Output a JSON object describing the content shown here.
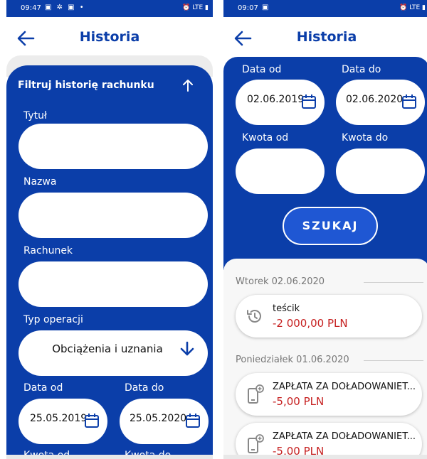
{
  "left": {
    "status": {
      "time": "09:47",
      "icons": "▣ ✲ ▣ •",
      "right_icons": "⏰ LTE ▮"
    },
    "header": {
      "title": "Historia"
    },
    "filter": {
      "title": "Filtruj historię rachunku",
      "tytul_label": "Tytuł",
      "nazwa_label": "Nazwa",
      "rachunek_label": "Rachunek",
      "typ_label": "Typ operacji",
      "typ_value": "Obciążenia i uznania",
      "date_from_label": "Data od",
      "date_to_label": "Data do",
      "date_from": "25.05.2019",
      "date_to": "25.05.2020",
      "amount_from_label": "Kwota od",
      "amount_to_label": "Kwota do"
    }
  },
  "right": {
    "status": {
      "time": "09:07",
      "icons": "▣",
      "right_icons": "⏰ LTE ▮"
    },
    "header": {
      "title": "Historia"
    },
    "filter": {
      "date_from_label": "Data od",
      "date_to_label": "Data do",
      "date_from": "02.06.2019",
      "date_to": "02.06.2020",
      "amount_from_label": "Kwota od",
      "amount_to_label": "Kwota do",
      "search_label": "SZUKAJ"
    },
    "groups": [
      {
        "day": "Wtorek 02.06.2020",
        "transactions": [
          {
            "title": "teścik",
            "amount": "-2 000,00 PLN"
          }
        ]
      },
      {
        "day": "Poniedziałek 01.06.2020",
        "transactions": [
          {
            "title": "ZAPŁATA ZA DOŁADOWANIET...",
            "amount": "-5,00 PLN"
          },
          {
            "title": "ZAPŁATA ZA DOŁADOWANIET...",
            "amount": "-5,00 PLN"
          }
        ]
      }
    ]
  },
  "colors": {
    "brand": "#0b3ea9",
    "button": "#1f57d3",
    "negative": "#c62020"
  }
}
